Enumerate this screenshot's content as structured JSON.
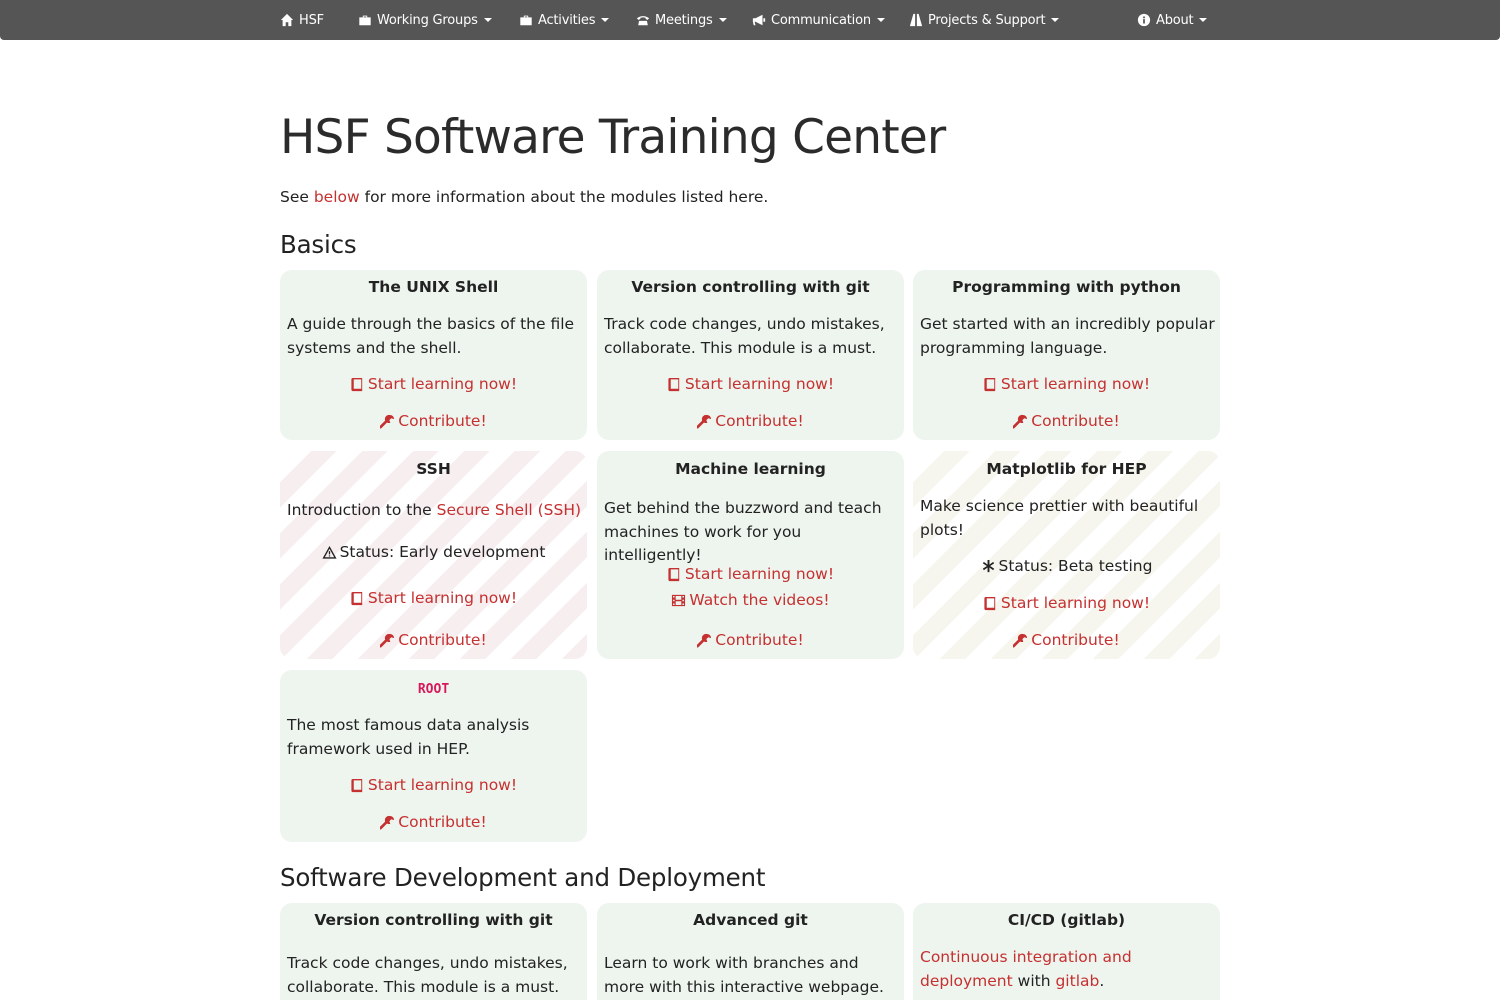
{
  "nav": {
    "brand": "HSF",
    "items": [
      {
        "label": "Working Groups"
      },
      {
        "label": "Activities"
      },
      {
        "label": "Meetings"
      },
      {
        "label": "Communication"
      },
      {
        "label": "Projects & Support"
      },
      {
        "label": "About"
      }
    ]
  },
  "page": {
    "title": "HSF Software Training Center",
    "intro_prefix": "See ",
    "intro_link": "below",
    "intro_suffix": " for more information about the modules listed here."
  },
  "sections": {
    "basics": "Basics",
    "software_dev": "Software Development and Deployment"
  },
  "actions": {
    "start": "Start learning now!",
    "contribute": "Contribute!",
    "videos": "Watch the videos!"
  },
  "cards": {
    "unix": {
      "title": "The UNIX Shell",
      "desc": "A guide through the basics of the file systems and the shell."
    },
    "git": {
      "title": "Version controlling with git",
      "desc": "Track code changes, undo mistakes, collaborate. This module is a must."
    },
    "python": {
      "title": "Programming with python",
      "desc": "Get started with an incredibly popular programming language."
    },
    "ssh": {
      "title": "SSH",
      "desc_prefix": "Introduction to the ",
      "desc_link": "Secure Shell (SSH)",
      "status": "Status: Early development"
    },
    "ml": {
      "title": "Machine learning",
      "desc": "Get behind the buzzword and teach machines to work for you intelligently!"
    },
    "matplotlib": {
      "title": "Matplotlib for HEP",
      "desc": "Make science prettier with beautiful plots!",
      "status": "Status: Beta testing"
    },
    "root": {
      "title": "ROOT",
      "desc": "The most famous data analysis framework used in HEP."
    },
    "git2": {
      "title": "Version controlling with git",
      "desc": "Track code changes, undo mistakes, collaborate. This module is a must."
    },
    "advgit": {
      "title": "Advanced git",
      "desc": "Learn to work with branches and more with this interactive webpage."
    },
    "cicd": {
      "title": "CI/CD (gitlab)",
      "desc_link": "Continuous integration and deployment",
      "desc_mid": " with ",
      "desc_link2": "gitlab",
      "desc_end": "."
    }
  },
  "colors": {
    "navbar": "#555555",
    "link": "#c53030",
    "card": "#eef5ef",
    "code": "#d6195b"
  }
}
